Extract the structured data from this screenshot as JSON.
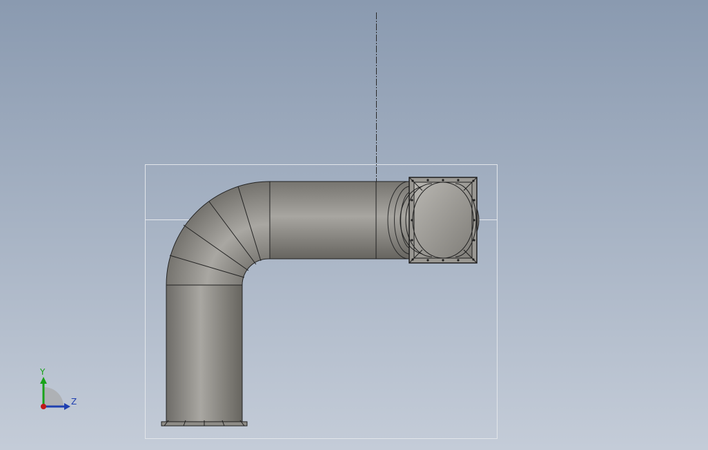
{
  "viewport": {
    "background_top": "#8a9ab0",
    "background_bottom": "#c4ccd8"
  },
  "model": {
    "name": "duct-elbow-with-square-flange",
    "body_color": "#8c8a85",
    "edge_color": "#1e1e1e"
  },
  "triad": {
    "y_label": "Y",
    "z_label": "Z",
    "y_color": "#19a319",
    "z_color": "#1f3fb0",
    "x_color": "#c01818"
  }
}
